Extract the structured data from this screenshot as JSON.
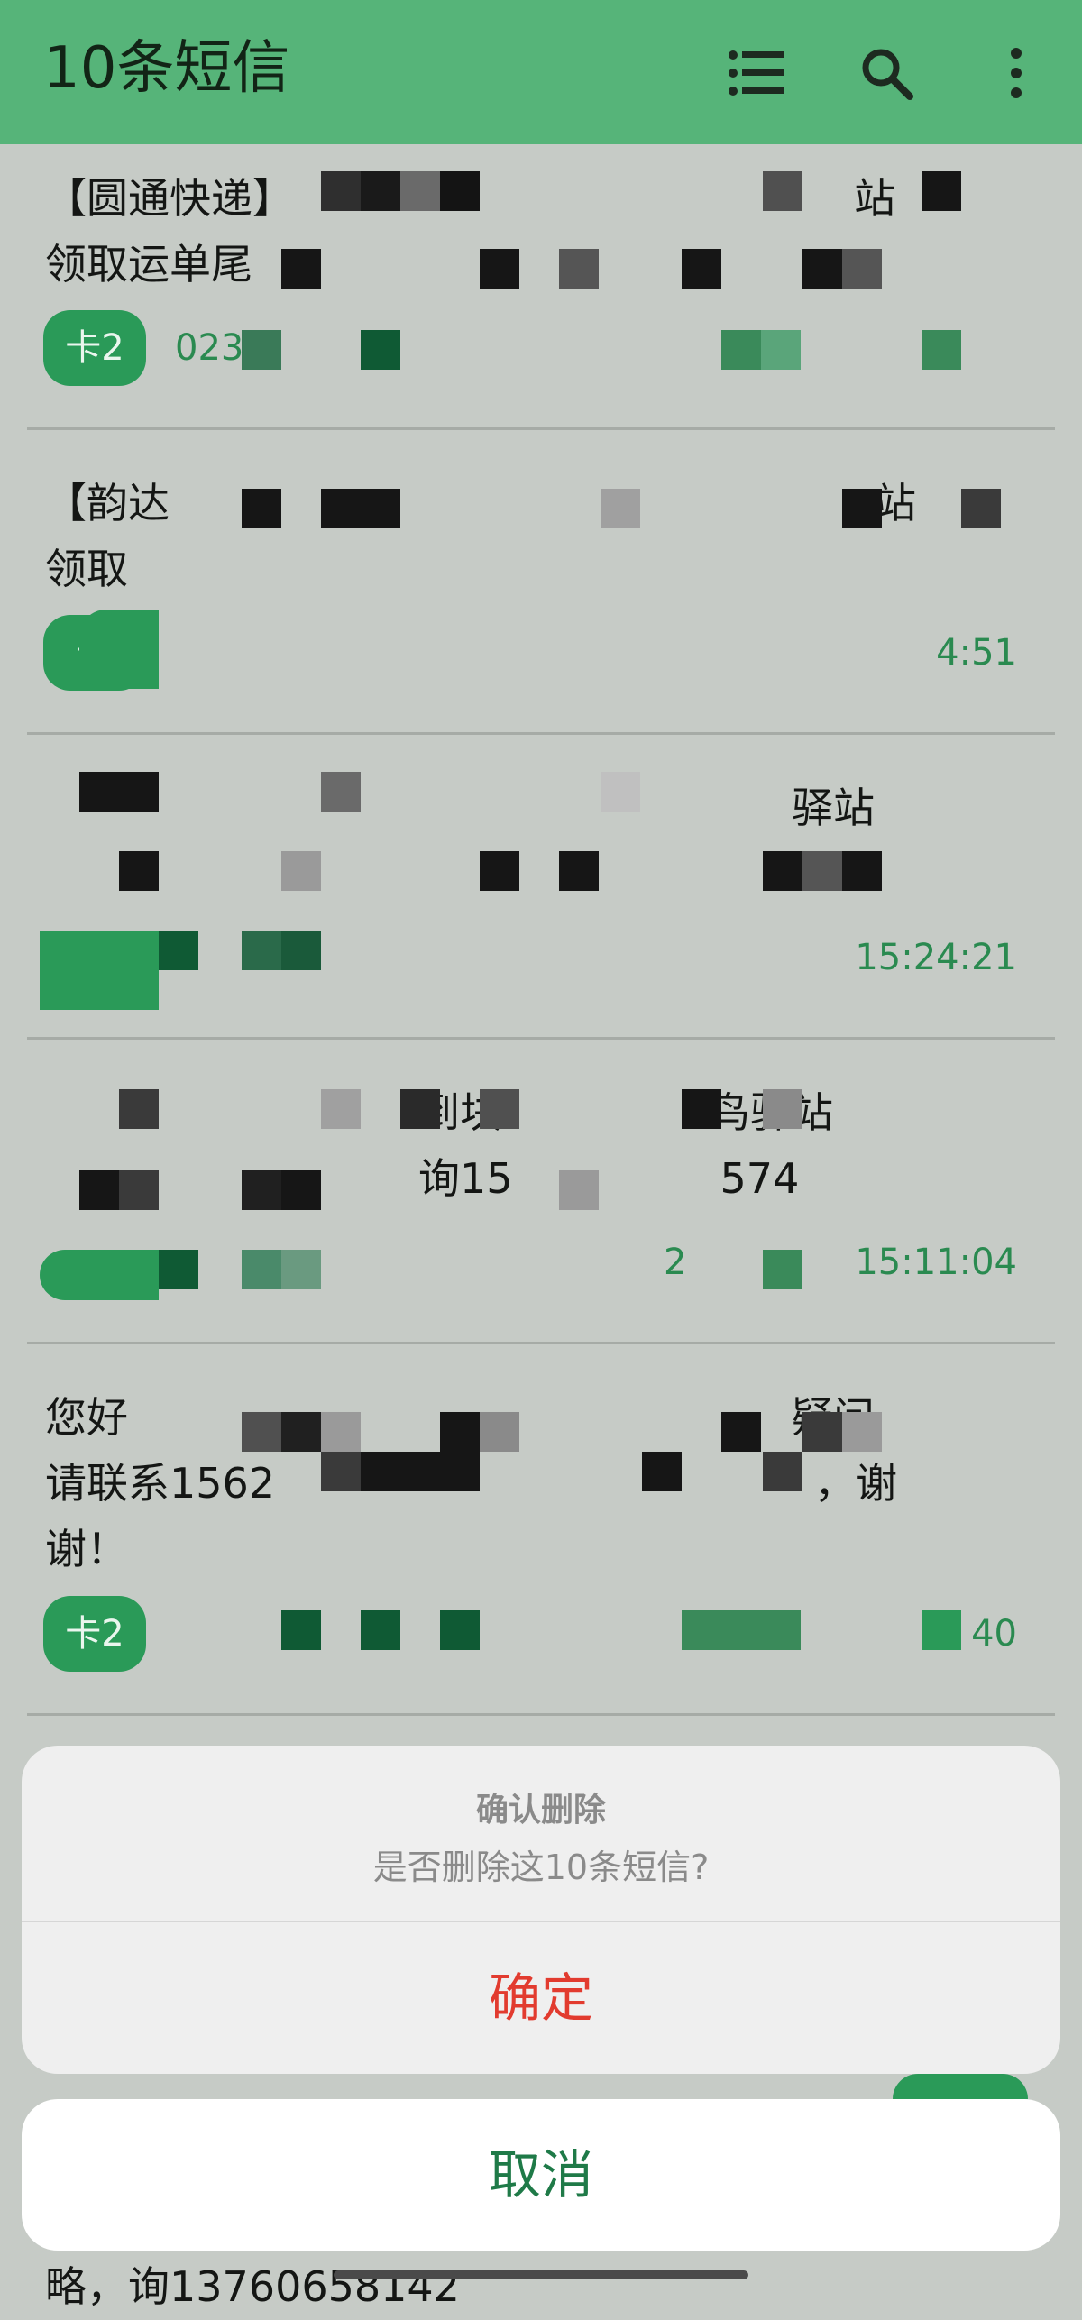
{
  "app_bar": {
    "title": "10条短信",
    "icons": [
      "list-icon",
      "search-icon",
      "more-vert-icon"
    ]
  },
  "messages": [
    {
      "text": "【圆通快递】　　　　　　　　　　　　　　站\n领取运单尾",
      "sim": "卡2",
      "number": "023",
      "time": ""
    },
    {
      "text": "【韵达　　　　　　　　　　　　　　　　　站\n领取",
      "sim": "卡",
      "number": "",
      "time": "4:51"
    },
    {
      "text": "　　　　　　　　　　　　　　　　　　驿站\n　　　　　　　　　　　　　　　　　　　4",
      "sim": "",
      "number": "",
      "time": "15:24:21"
    },
    {
      "text": "　　　　　　　　　到块　　　　　鸟驿站\n　　　　　　　　　询15　　　　　574",
      "sim": "",
      "number": "2",
      "time": "15:11:04"
    },
    {
      "text": "您好　　　　　　　　　　　　　　　　疑问\n请联系1562　　　　　　　　　　　　　，谢\n谢！",
      "sim": "卡2",
      "number": "",
      "time": "40"
    }
  ],
  "dialog": {
    "title": "确认删除",
    "message": "是否删除这10条短信?",
    "confirm": "确定",
    "cancel": "取消"
  },
  "behind_text": "略，询13760658142",
  "colors": {
    "app_bar": "#56b479",
    "accent_green": "#2a9a58",
    "confirm_red": "#e23b2f",
    "cancel_green": "#1f7a48"
  }
}
